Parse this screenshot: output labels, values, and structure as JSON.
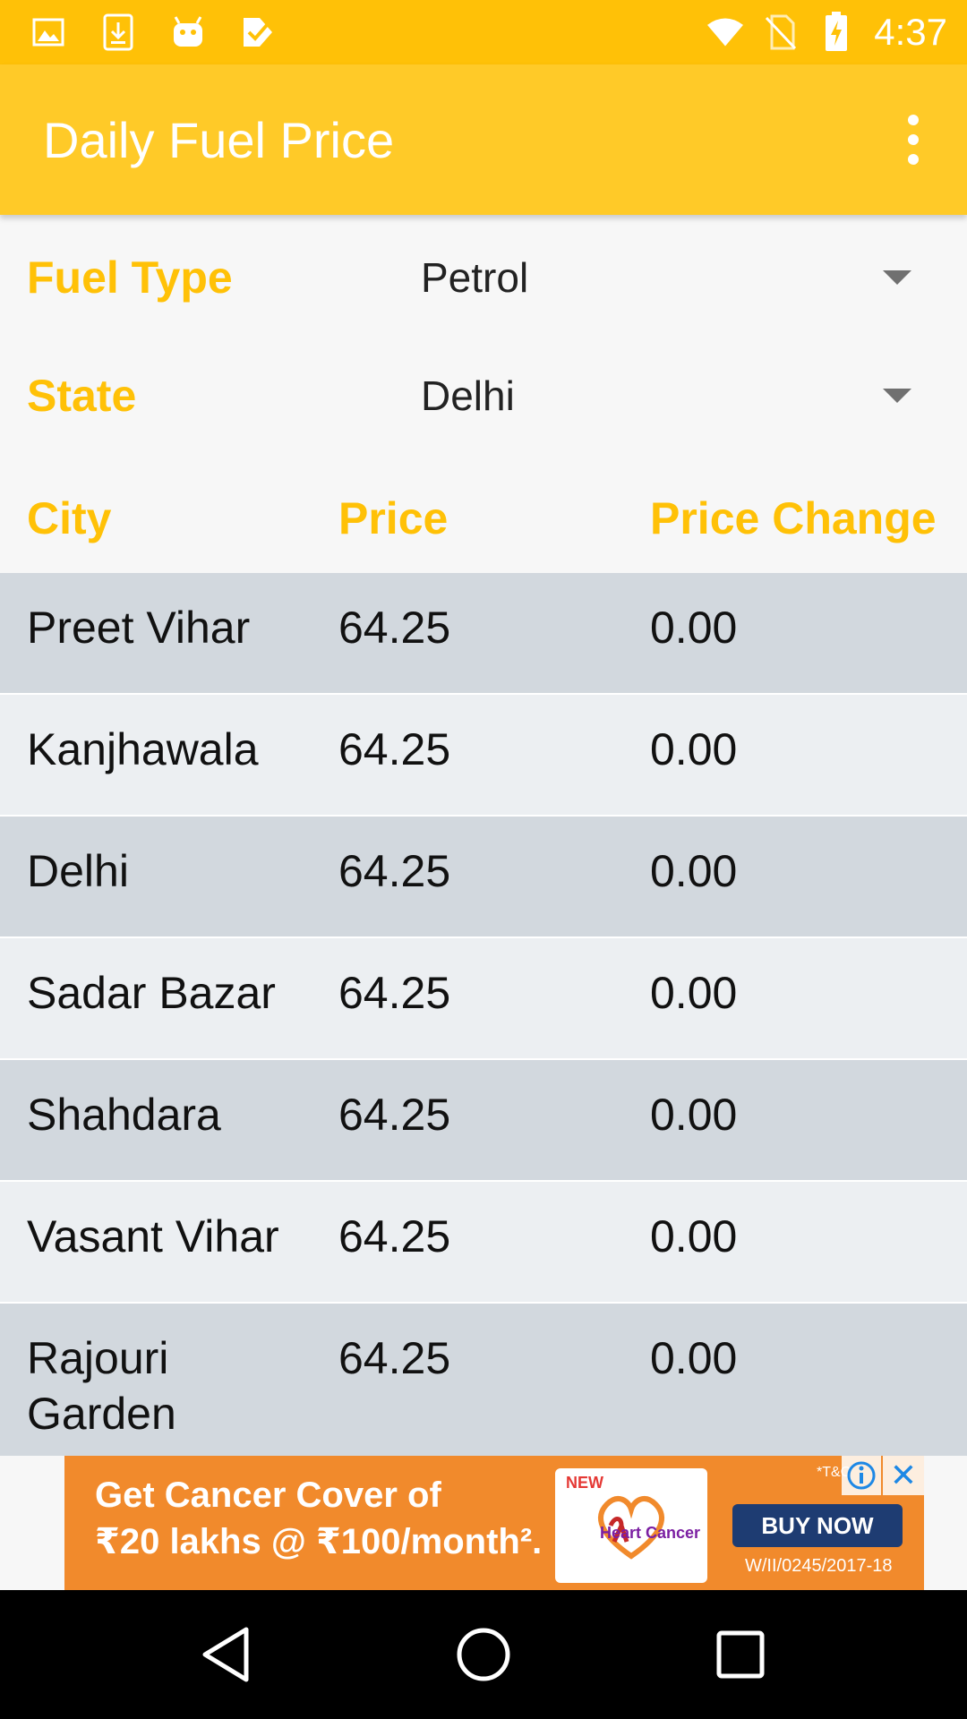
{
  "status_bar": {
    "time": "4:37",
    "left_icons": [
      "image-icon",
      "download-icon",
      "android-icon",
      "tasks-icon"
    ],
    "right_icons": [
      "wifi-icon",
      "no-sim-icon",
      "battery-charging-icon"
    ]
  },
  "app_bar": {
    "title": "Daily Fuel Price",
    "menu_icon": "overflow-menu-icon"
  },
  "filters": {
    "fuel_type": {
      "label": "Fuel Type",
      "value": "Petrol"
    },
    "state": {
      "label": "State",
      "value": "Delhi"
    }
  },
  "table": {
    "headers": {
      "city": "City",
      "price": "Price",
      "change": "Price Change"
    },
    "rows": [
      {
        "city": "Preet Vihar",
        "price": "64.25",
        "change": "0.00"
      },
      {
        "city": "Kanjhawala",
        "price": "64.25",
        "change": "0.00"
      },
      {
        "city": "Delhi",
        "price": "64.25",
        "change": "0.00"
      },
      {
        "city": "Sadar Bazar",
        "price": "64.25",
        "change": "0.00"
      },
      {
        "city": "Shahdara",
        "price": "64.25",
        "change": "0.00"
      },
      {
        "city": "Vasant Vihar",
        "price": "64.25",
        "change": "0.00"
      },
      {
        "city": "Rajouri Garden",
        "price": "64.25",
        "change": "0.00"
      }
    ]
  },
  "ad": {
    "line1": "Get Cancer Cover of",
    "line2": "₹20 lakhs @ ₹100/month².",
    "badge": "NEW",
    "product": "Heart Cancer",
    "cta": "BUY NOW",
    "code": "W/II/0245/2017-18",
    "tc": "*T&C"
  },
  "colors": {
    "status_bar": "#ffc107",
    "app_bar": "#ffca28",
    "accent_label": "#ffc107",
    "row_odd": "#d2d8de",
    "row_even": "#eceff2"
  }
}
